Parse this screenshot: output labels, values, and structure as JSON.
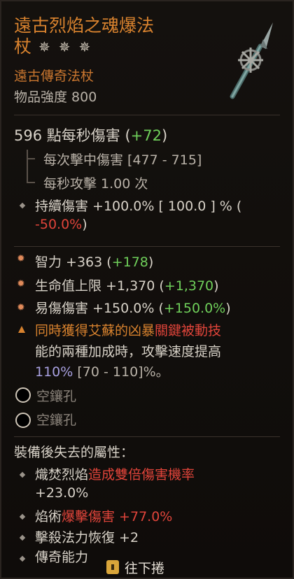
{
  "item": {
    "name_line1": "遠古烈焰之魂爆法",
    "name_line2": "杖",
    "stars": "✵✵✵",
    "rarity": "遠古傳奇法杖",
    "power": "物品強度 800"
  },
  "dps": {
    "value": "596 點每秒傷害",
    "delta_open": "(",
    "delta": "+72",
    "delta_close": ")"
  },
  "weapon_stats": [
    {
      "text": "每次擊中傷害 [477 - 715]"
    },
    {
      "text": "每秒攻擊 1.00 次"
    }
  ],
  "implicit": {
    "line1": "持續傷害 +100.0%   [ 100.0 ] % (",
    "line2": "-50.0%",
    "line2_close": ")"
  },
  "affixes": [
    {
      "label": "智力 +363 (",
      "delta": "+178",
      "close": ")"
    },
    {
      "label": "生命值上限 +1,370 (",
      "delta": "+1,370",
      "close": ")"
    },
    {
      "label": "易傷傷害 +150.0% (",
      "delta": "+150.0%",
      "close": ")"
    }
  ],
  "legendary": {
    "line1_orange": "同時獲得艾蘇的凶暴",
    "line1_red": "關鍵被動技",
    "line2": "能的兩種加成時，攻擊速度提高",
    "line3_value": "110%",
    "line3_range": " [70 - 110]%。"
  },
  "sockets": [
    "空鑲孔",
    "空鑲孔"
  ],
  "lost": {
    "header": "裝備後失去的屬性：",
    "items": [
      {
        "prefix": "熾焚烈焰",
        "red": "造成雙倍傷害機率",
        "line2": "+23.0%"
      },
      {
        "prefix": "焰術",
        "red": "爆擊傷害 +77.0%"
      },
      {
        "prefix": "",
        "red": "擊殺法力恢復 +2"
      },
      {
        "prefix": "",
        "red": "傳奇能力"
      }
    ]
  },
  "footer": {
    "icon": "scroll-icon",
    "label": "往下捲"
  }
}
